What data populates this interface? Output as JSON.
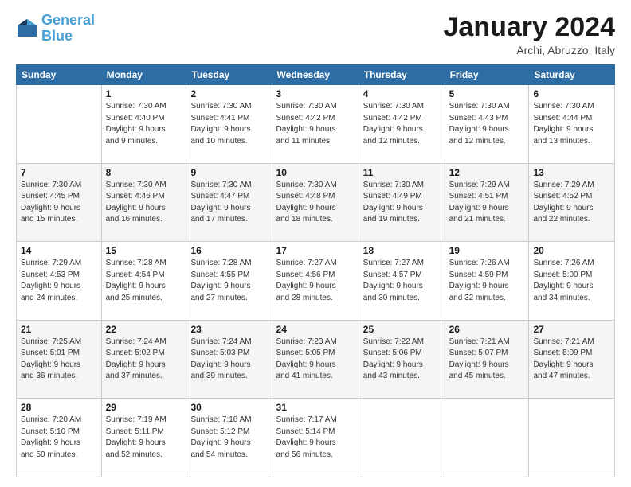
{
  "logo": {
    "line1": "General",
    "line2": "Blue"
  },
  "header": {
    "month": "January 2024",
    "location": "Archi, Abruzzo, Italy"
  },
  "weekdays": [
    "Sunday",
    "Monday",
    "Tuesday",
    "Wednesday",
    "Thursday",
    "Friday",
    "Saturday"
  ],
  "weeks": [
    [
      {
        "num": "",
        "info": ""
      },
      {
        "num": "1",
        "info": "Sunrise: 7:30 AM\nSunset: 4:40 PM\nDaylight: 9 hours\nand 9 minutes."
      },
      {
        "num": "2",
        "info": "Sunrise: 7:30 AM\nSunset: 4:41 PM\nDaylight: 9 hours\nand 10 minutes."
      },
      {
        "num": "3",
        "info": "Sunrise: 7:30 AM\nSunset: 4:42 PM\nDaylight: 9 hours\nand 11 minutes."
      },
      {
        "num": "4",
        "info": "Sunrise: 7:30 AM\nSunset: 4:42 PM\nDaylight: 9 hours\nand 12 minutes."
      },
      {
        "num": "5",
        "info": "Sunrise: 7:30 AM\nSunset: 4:43 PM\nDaylight: 9 hours\nand 12 minutes."
      },
      {
        "num": "6",
        "info": "Sunrise: 7:30 AM\nSunset: 4:44 PM\nDaylight: 9 hours\nand 13 minutes."
      }
    ],
    [
      {
        "num": "7",
        "info": "Sunrise: 7:30 AM\nSunset: 4:45 PM\nDaylight: 9 hours\nand 15 minutes."
      },
      {
        "num": "8",
        "info": "Sunrise: 7:30 AM\nSunset: 4:46 PM\nDaylight: 9 hours\nand 16 minutes."
      },
      {
        "num": "9",
        "info": "Sunrise: 7:30 AM\nSunset: 4:47 PM\nDaylight: 9 hours\nand 17 minutes."
      },
      {
        "num": "10",
        "info": "Sunrise: 7:30 AM\nSunset: 4:48 PM\nDaylight: 9 hours\nand 18 minutes."
      },
      {
        "num": "11",
        "info": "Sunrise: 7:30 AM\nSunset: 4:49 PM\nDaylight: 9 hours\nand 19 minutes."
      },
      {
        "num": "12",
        "info": "Sunrise: 7:29 AM\nSunset: 4:51 PM\nDaylight: 9 hours\nand 21 minutes."
      },
      {
        "num": "13",
        "info": "Sunrise: 7:29 AM\nSunset: 4:52 PM\nDaylight: 9 hours\nand 22 minutes."
      }
    ],
    [
      {
        "num": "14",
        "info": "Sunrise: 7:29 AM\nSunset: 4:53 PM\nDaylight: 9 hours\nand 24 minutes."
      },
      {
        "num": "15",
        "info": "Sunrise: 7:28 AM\nSunset: 4:54 PM\nDaylight: 9 hours\nand 25 minutes."
      },
      {
        "num": "16",
        "info": "Sunrise: 7:28 AM\nSunset: 4:55 PM\nDaylight: 9 hours\nand 27 minutes."
      },
      {
        "num": "17",
        "info": "Sunrise: 7:27 AM\nSunset: 4:56 PM\nDaylight: 9 hours\nand 28 minutes."
      },
      {
        "num": "18",
        "info": "Sunrise: 7:27 AM\nSunset: 4:57 PM\nDaylight: 9 hours\nand 30 minutes."
      },
      {
        "num": "19",
        "info": "Sunrise: 7:26 AM\nSunset: 4:59 PM\nDaylight: 9 hours\nand 32 minutes."
      },
      {
        "num": "20",
        "info": "Sunrise: 7:26 AM\nSunset: 5:00 PM\nDaylight: 9 hours\nand 34 minutes."
      }
    ],
    [
      {
        "num": "21",
        "info": "Sunrise: 7:25 AM\nSunset: 5:01 PM\nDaylight: 9 hours\nand 36 minutes."
      },
      {
        "num": "22",
        "info": "Sunrise: 7:24 AM\nSunset: 5:02 PM\nDaylight: 9 hours\nand 37 minutes."
      },
      {
        "num": "23",
        "info": "Sunrise: 7:24 AM\nSunset: 5:03 PM\nDaylight: 9 hours\nand 39 minutes."
      },
      {
        "num": "24",
        "info": "Sunrise: 7:23 AM\nSunset: 5:05 PM\nDaylight: 9 hours\nand 41 minutes."
      },
      {
        "num": "25",
        "info": "Sunrise: 7:22 AM\nSunset: 5:06 PM\nDaylight: 9 hours\nand 43 minutes."
      },
      {
        "num": "26",
        "info": "Sunrise: 7:21 AM\nSunset: 5:07 PM\nDaylight: 9 hours\nand 45 minutes."
      },
      {
        "num": "27",
        "info": "Sunrise: 7:21 AM\nSunset: 5:09 PM\nDaylight: 9 hours\nand 47 minutes."
      }
    ],
    [
      {
        "num": "28",
        "info": "Sunrise: 7:20 AM\nSunset: 5:10 PM\nDaylight: 9 hours\nand 50 minutes."
      },
      {
        "num": "29",
        "info": "Sunrise: 7:19 AM\nSunset: 5:11 PM\nDaylight: 9 hours\nand 52 minutes."
      },
      {
        "num": "30",
        "info": "Sunrise: 7:18 AM\nSunset: 5:12 PM\nDaylight: 9 hours\nand 54 minutes."
      },
      {
        "num": "31",
        "info": "Sunrise: 7:17 AM\nSunset: 5:14 PM\nDaylight: 9 hours\nand 56 minutes."
      },
      {
        "num": "",
        "info": ""
      },
      {
        "num": "",
        "info": ""
      },
      {
        "num": "",
        "info": ""
      }
    ]
  ]
}
